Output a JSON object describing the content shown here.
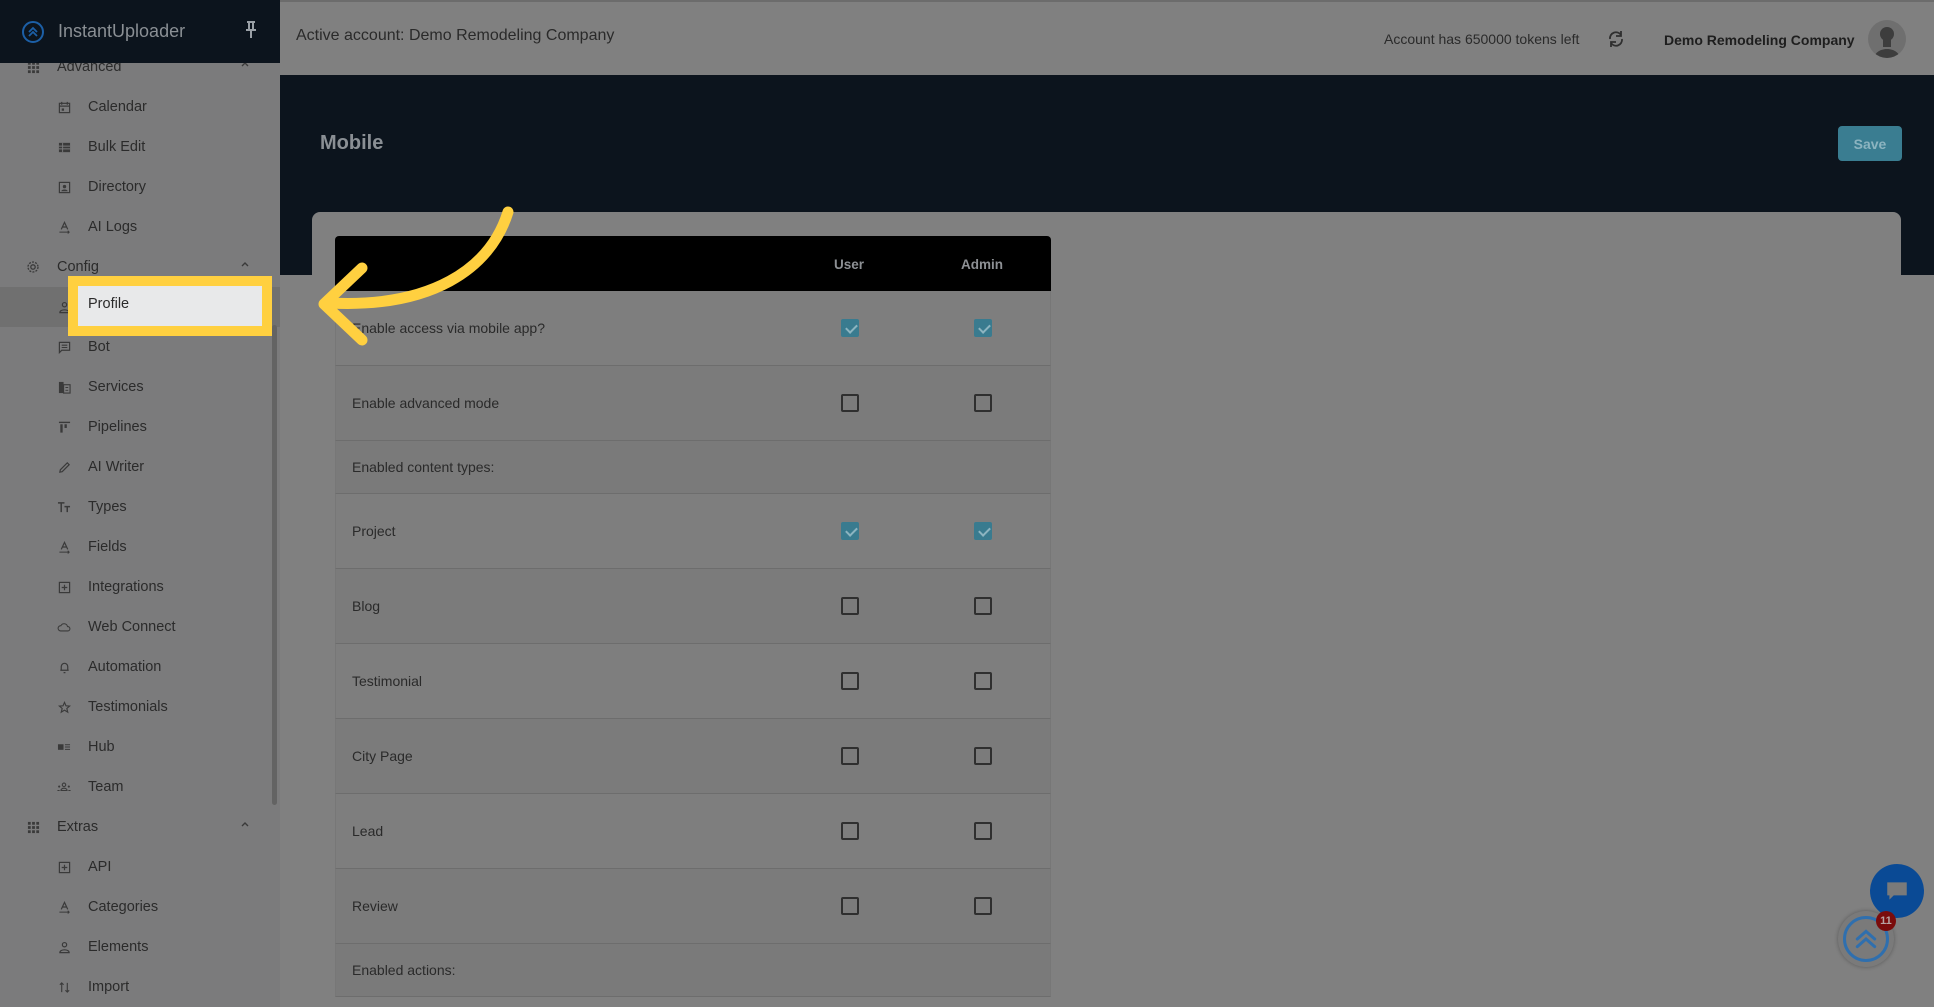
{
  "app": {
    "name": "InstantUploader",
    "brand_color": "#1c5fa6",
    "highlight_color": "#ffd040"
  },
  "sidebar": {
    "groups": [
      {
        "label": "Advanced",
        "icon": "grid-icon",
        "expanded": true,
        "items": [
          {
            "label": "Calendar",
            "icon": "calendar-icon"
          },
          {
            "label": "Bulk Edit",
            "icon": "table-icon"
          },
          {
            "label": "Directory",
            "icon": "contact-card-icon"
          },
          {
            "label": "AI Logs",
            "icon": "text-format-icon"
          }
        ]
      },
      {
        "label": "Config",
        "icon": "gear-icon",
        "expanded": true,
        "items": [
          {
            "label": "Profile",
            "icon": "user-icon",
            "active": true
          },
          {
            "label": "Bot",
            "icon": "message-icon"
          },
          {
            "label": "Services",
            "icon": "building-icon"
          },
          {
            "label": "Pipelines",
            "icon": "pipeline-icon"
          },
          {
            "label": "AI Writer",
            "icon": "pencil-icon"
          },
          {
            "label": "Types",
            "icon": "text-size-icon"
          },
          {
            "label": "Fields",
            "icon": "text-format-icon"
          },
          {
            "label": "Integrations",
            "icon": "plus-box-icon"
          },
          {
            "label": "Web Connect",
            "icon": "cloud-icon"
          },
          {
            "label": "Automation",
            "icon": "bell-icon"
          },
          {
            "label": "Testimonials",
            "icon": "star-icon"
          },
          {
            "label": "Hub",
            "icon": "card-list-icon"
          },
          {
            "label": "Team",
            "icon": "team-icon"
          }
        ]
      },
      {
        "label": "Extras",
        "icon": "grid-icon",
        "expanded": true,
        "items": [
          {
            "label": "API",
            "icon": "plus-box-icon"
          },
          {
            "label": "Categories",
            "icon": "text-format-icon"
          },
          {
            "label": "Elements",
            "icon": "user-icon"
          },
          {
            "label": "Import",
            "icon": "sort-arrows-icon"
          }
        ]
      }
    ]
  },
  "topbar": {
    "active_account": "Active account: Demo Remodeling Company",
    "tokens_text": "Account has 650000 tokens left",
    "company_name": "Demo Remodeling Company"
  },
  "page": {
    "title": "Mobile",
    "save_label": "Save",
    "save_color": "#3a7d91"
  },
  "table": {
    "columns": [
      "",
      "User",
      "Admin"
    ],
    "rows": [
      {
        "type": "setting",
        "label": "Enable access via mobile app?",
        "user": true,
        "admin": true
      },
      {
        "type": "setting",
        "label": "Enable advanced mode",
        "user": false,
        "admin": false
      },
      {
        "type": "section",
        "label": "Enabled content types:"
      },
      {
        "type": "setting",
        "label": "Project",
        "user": true,
        "admin": true
      },
      {
        "type": "setting",
        "label": "Blog",
        "user": false,
        "admin": false
      },
      {
        "type": "setting",
        "label": "Testimonial",
        "user": false,
        "admin": false
      },
      {
        "type": "setting",
        "label": "City Page",
        "user": false,
        "admin": false
      },
      {
        "type": "setting",
        "label": "Lead",
        "user": false,
        "admin": false
      },
      {
        "type": "setting",
        "label": "Review",
        "user": false,
        "admin": false
      },
      {
        "type": "section",
        "label": "Enabled actions:"
      }
    ]
  },
  "widgets": {
    "notification_count": "11"
  }
}
